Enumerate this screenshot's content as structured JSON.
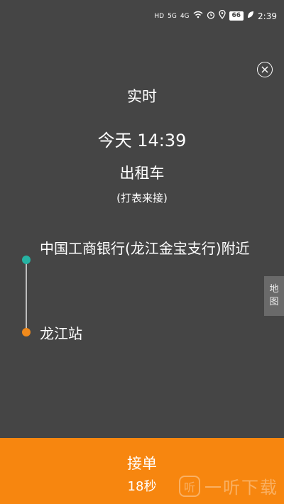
{
  "status_bar": {
    "hd_label": "HD",
    "net1": "5G",
    "net2": "4G",
    "battery": "66",
    "time": "2:39"
  },
  "order": {
    "mode": "实时",
    "time": "今天  14:39",
    "car_type": "出租车",
    "meter_note": "(打表来接)"
  },
  "route": {
    "from": "中国工商银行(龙江金宝支行)附近",
    "to": "龙江站"
  },
  "map_tab": [
    "地",
    "图"
  ],
  "accept": {
    "label": "接单",
    "countdown": "18秒"
  },
  "watermark": {
    "badge": "听",
    "text": "一听下载"
  },
  "colors": {
    "background": "#454545",
    "accent": "#f7860f",
    "start_dot": "#26b3a3",
    "end_dot": "#f08a1c"
  }
}
